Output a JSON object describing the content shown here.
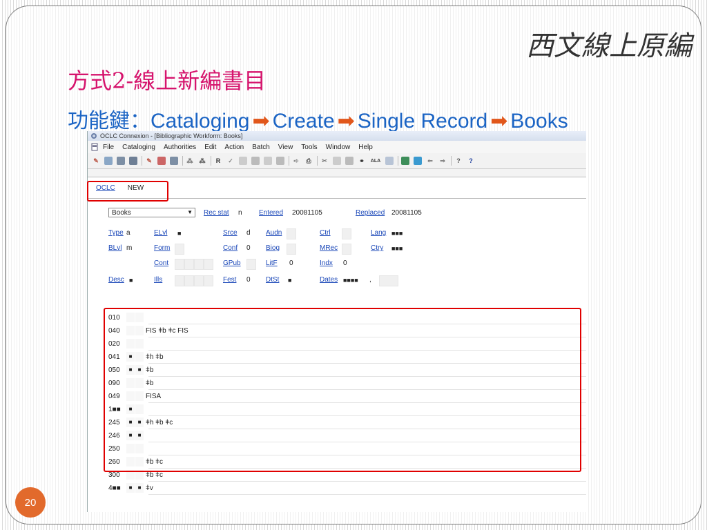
{
  "slide": {
    "corner_title": "西文線上原編",
    "heading": "方式2-線上新編書目",
    "subheading_prefix": "功能鍵：",
    "path": [
      "Cataloging",
      "Create",
      "Single Record",
      "Books"
    ],
    "page_number": "20"
  },
  "window": {
    "title": "OCLC Connexion - [Bibliographic Workform: Books]",
    "menu": [
      "File",
      "Cataloging",
      "Authorities",
      "Edit",
      "Action",
      "Batch",
      "View",
      "Tools",
      "Window",
      "Help"
    ],
    "toolbar_icons": [
      "search-icon",
      "browse-icon",
      "find-icon",
      "find-all-icon",
      "sep",
      "authority-search-icon",
      "authority-browse-icon",
      "authority-find-icon",
      "sep",
      "recall-icon",
      "recall-list-icon",
      "sep",
      "reformat-icon",
      "validate-icon",
      "copy-icon",
      "paste-icon",
      "insert-icon",
      "delete-icon",
      "sep",
      "send-icon",
      "print-icon",
      "sep",
      "cut-icon",
      "copy2-icon",
      "paste2-icon",
      "binoculars-icon",
      "ala-icon",
      "field-icon",
      "sep",
      "constant-icon",
      "view-icon",
      "back-icon",
      "forward-icon",
      "sep",
      "help-icon",
      "question-icon"
    ]
  },
  "record": {
    "system": "OCLC",
    "status": "NEW",
    "format": "Books",
    "fixed_fields": {
      "rec_stat": {
        "label": "Rec stat",
        "value": "n"
      },
      "entered": {
        "label": "Entered",
        "value": "20081105"
      },
      "replaced": {
        "label": "Replaced",
        "value": "20081105"
      },
      "type": {
        "label": "Type",
        "value": "a"
      },
      "elvl": {
        "label": "ELvl",
        "value": "■"
      },
      "srce": {
        "label": "Srce",
        "value": "d"
      },
      "audn": {
        "label": "Audn",
        "value": ""
      },
      "ctrl": {
        "label": "Ctrl",
        "value": ""
      },
      "lang": {
        "label": "Lang",
        "value": "■■■"
      },
      "blvl": {
        "label": "BLvl",
        "value": "m"
      },
      "form": {
        "label": "Form",
        "value": ""
      },
      "conf": {
        "label": "Conf",
        "value": "0"
      },
      "biog": {
        "label": "Biog",
        "value": ""
      },
      "mrec": {
        "label": "MRec",
        "value": ""
      },
      "ctry": {
        "label": "Ctry",
        "value": "■■■"
      },
      "cont": {
        "label": "Cont",
        "value": ""
      },
      "gpub": {
        "label": "GPub",
        "value": ""
      },
      "litf": {
        "label": "LitF",
        "value": "0"
      },
      "indx": {
        "label": "Indx",
        "value": "0"
      },
      "desc": {
        "label": "Desc",
        "value": "■"
      },
      "ills": {
        "label": "Ills",
        "value": ""
      },
      "fest": {
        "label": "Fest",
        "value": "0"
      },
      "dtst": {
        "label": "DtSt",
        "value": "■"
      },
      "dates": {
        "label": "Dates",
        "value": "■■■■",
        "sep": ","
      }
    },
    "var_fields": [
      {
        "tag": "010",
        "i1": "",
        "i2": "",
        "text": ""
      },
      {
        "tag": "040",
        "i1": "",
        "i2": "",
        "text": "FIS ǂb ǂc FIS"
      },
      {
        "tag": "020",
        "i1": "",
        "i2": "",
        "text": ""
      },
      {
        "tag": "041",
        "i1": "■",
        "i2": "",
        "text": "ǂh ǂb"
      },
      {
        "tag": "050",
        "i1": "■",
        "i2": "■",
        "text": "ǂb"
      },
      {
        "tag": "090",
        "i1": "",
        "i2": "",
        "text": "ǂb"
      },
      {
        "tag": "049",
        "i1": "",
        "i2": "",
        "text": "FISA"
      },
      {
        "tag": "1■■",
        "i1": "■",
        "i2": "",
        "text": ""
      },
      {
        "tag": "245",
        "i1": "■",
        "i2": "■",
        "text": "ǂh ǂb ǂc"
      },
      {
        "tag": "246",
        "i1": "■",
        "i2": "■",
        "text": ""
      },
      {
        "tag": "250",
        "i1": "",
        "i2": "",
        "text": ""
      },
      {
        "tag": "260",
        "i1": "",
        "i2": "",
        "text": "ǂb ǂc"
      },
      {
        "tag": "300",
        "i1": "",
        "i2": "",
        "text": "ǂb ǂc"
      },
      {
        "tag": "4■■",
        "i1": "■",
        "i2": "■",
        "text": "ǂv"
      }
    ]
  }
}
